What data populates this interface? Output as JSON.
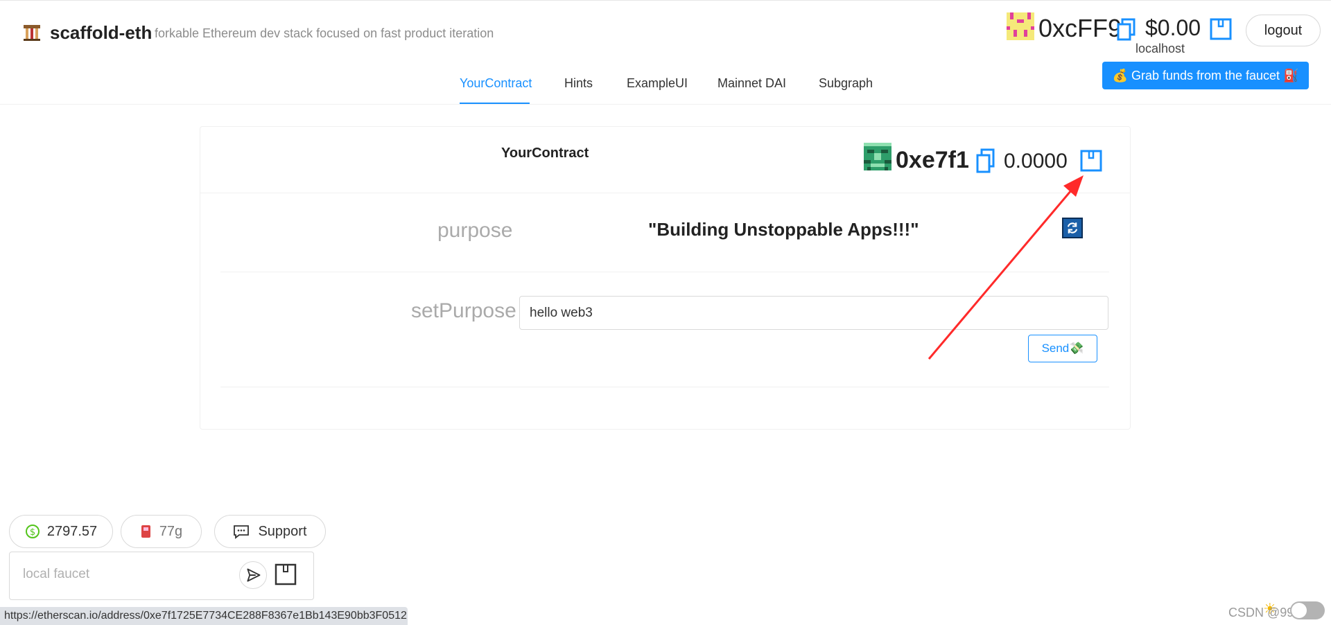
{
  "header": {
    "title": "scaffold-eth",
    "subtitle": "forkable Ethereum dev stack focused on fast product iteration",
    "logo_icon": "building-icon",
    "account": {
      "address": "0xcFF9",
      "balance": "$0.00",
      "network": "localhost"
    },
    "logout_label": "logout",
    "faucet_button_label": "💰 Grab funds from the faucet ⛽"
  },
  "tabs": [
    {
      "label": "YourContract",
      "active": true
    },
    {
      "label": "Hints",
      "active": false
    },
    {
      "label": "ExampleUI",
      "active": false
    },
    {
      "label": "Mainnet DAI",
      "active": false
    },
    {
      "label": "Subgraph",
      "active": false
    }
  ],
  "contract_card": {
    "title": "YourContract",
    "address": "0xe7f1",
    "balance": "0.0000",
    "purpose": {
      "label": "purpose",
      "value": "\"Building Unstoppable Apps!!!\""
    },
    "setPurpose": {
      "label": "setPurpose",
      "input_value": "hello web3",
      "send_label": "Send💸"
    }
  },
  "bottom": {
    "eth_price": "2797.57",
    "gas": "77g",
    "support_label": "Support",
    "faucet_placeholder": "local faucet"
  },
  "statusbar": {
    "url": "https://etherscan.io/address/0xe7f1725E7734CE288F8367e1Bb143E90bb3F0512"
  },
  "watermark": "CSDN @99Kies",
  "colors": {
    "accent": "#1890ff",
    "annotation_arrow": "#ff2a2a"
  }
}
